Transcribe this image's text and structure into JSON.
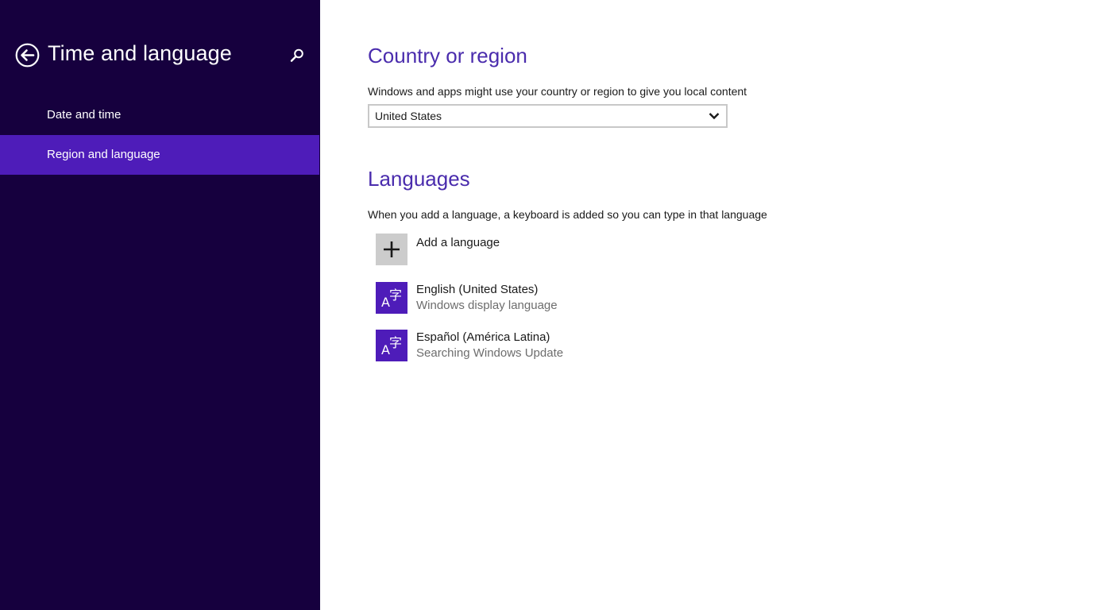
{
  "sidebar": {
    "title": "Time and language",
    "items": [
      {
        "label": "Date and time",
        "active": false
      },
      {
        "label": "Region and language",
        "active": true
      }
    ]
  },
  "country": {
    "heading": "Country or region",
    "description": "Windows and apps might use your country or region to give you local content",
    "selected": "United States"
  },
  "languages": {
    "heading": "Languages",
    "description": "When you add a language, a keyboard is added so you can type in that language",
    "add_label": "Add a language",
    "items": [
      {
        "name": "English (United States)",
        "status": "Windows display language"
      },
      {
        "name": "Español (América Latina)",
        "status": "Searching Windows Update"
      }
    ]
  },
  "icons": {
    "back": "back-arrow-circle-icon",
    "search": "search-icon",
    "chevron": "chevron-down-icon",
    "add": "plus-icon",
    "language": "language-a-character-icon"
  },
  "colors": {
    "sidebar_bg": "#16003e",
    "active_item": "#4e1cb9",
    "heading": "#4a2cad",
    "tile_add": "#cccccc"
  }
}
